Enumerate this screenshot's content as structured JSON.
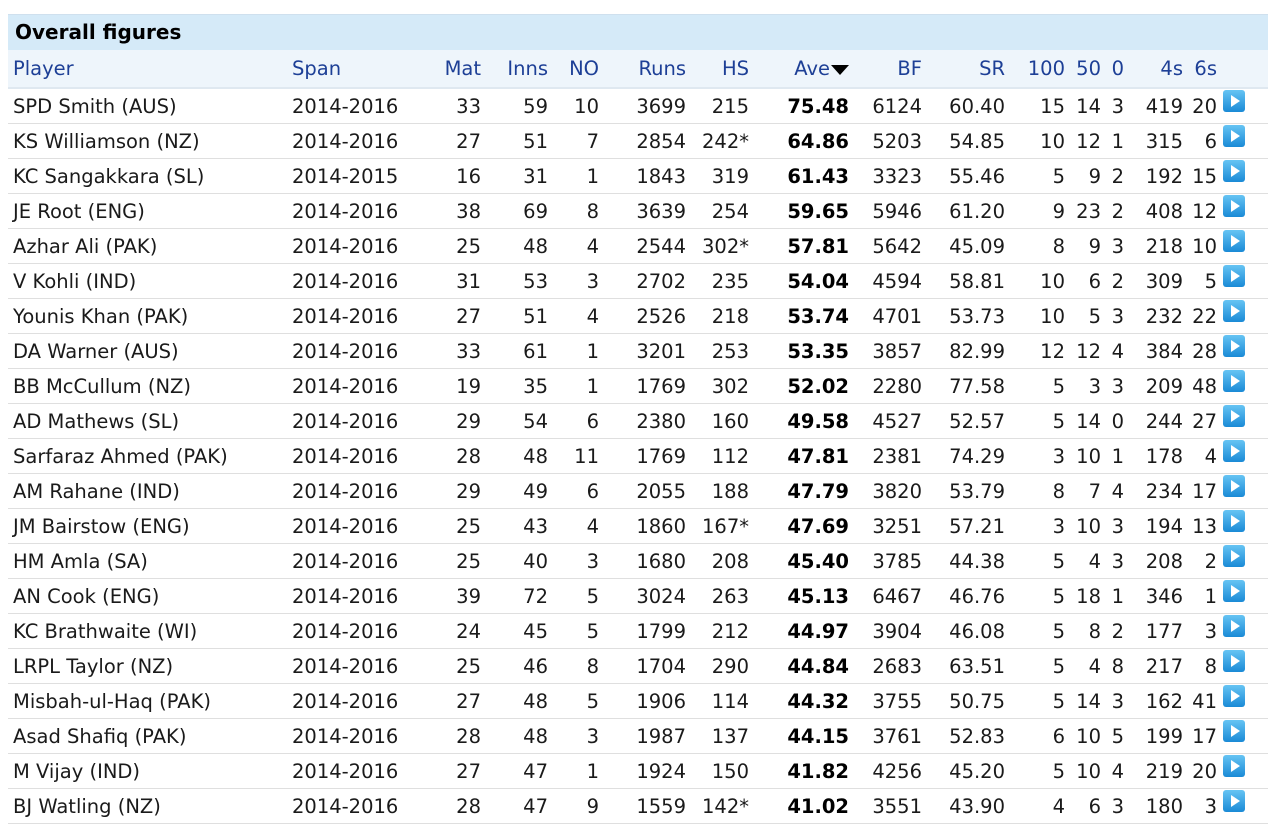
{
  "caption": "Overall figures",
  "columns": {
    "player": "Player",
    "span": "Span",
    "mat": "Mat",
    "inns": "Inns",
    "no": "NO",
    "runs": "Runs",
    "hs": "HS",
    "ave": "Ave",
    "bf": "BF",
    "sr": "SR",
    "hundreds": "100",
    "fifties": "50",
    "ducks": "0",
    "fours": "4s",
    "sixes": "6s"
  },
  "sorted_column": "Ave",
  "sort_icon": "sort-descending-icon",
  "row_icon": "play-arrow-icon",
  "colors": {
    "caption_bg": "#d5eaf8",
    "header_text": "#1d3f96",
    "icon": "#2a95dd"
  },
  "rows": [
    {
      "player": "SPD Smith (AUS)",
      "span": "2014-2016",
      "mat": "33",
      "inns": "59",
      "no": "10",
      "runs": "3699",
      "hs": "215",
      "ave": "75.48",
      "bf": "6124",
      "sr": "60.40",
      "hundreds": "15",
      "fifties": "14",
      "ducks": "3",
      "fours": "419",
      "sixes": "20"
    },
    {
      "player": "KS Williamson (NZ)",
      "span": "2014-2016",
      "mat": "27",
      "inns": "51",
      "no": "7",
      "runs": "2854",
      "hs": "242*",
      "ave": "64.86",
      "bf": "5203",
      "sr": "54.85",
      "hundreds": "10",
      "fifties": "12",
      "ducks": "1",
      "fours": "315",
      "sixes": "6"
    },
    {
      "player": "KC Sangakkara (SL)",
      "span": "2014-2015",
      "mat": "16",
      "inns": "31",
      "no": "1",
      "runs": "1843",
      "hs": "319",
      "ave": "61.43",
      "bf": "3323",
      "sr": "55.46",
      "hundreds": "5",
      "fifties": "9",
      "ducks": "2",
      "fours": "192",
      "sixes": "15"
    },
    {
      "player": "JE Root (ENG)",
      "span": "2014-2016",
      "mat": "38",
      "inns": "69",
      "no": "8",
      "runs": "3639",
      "hs": "254",
      "ave": "59.65",
      "bf": "5946",
      "sr": "61.20",
      "hundreds": "9",
      "fifties": "23",
      "ducks": "2",
      "fours": "408",
      "sixes": "12"
    },
    {
      "player": "Azhar Ali (PAK)",
      "span": "2014-2016",
      "mat": "25",
      "inns": "48",
      "no": "4",
      "runs": "2544",
      "hs": "302*",
      "ave": "57.81",
      "bf": "5642",
      "sr": "45.09",
      "hundreds": "8",
      "fifties": "9",
      "ducks": "3",
      "fours": "218",
      "sixes": "10"
    },
    {
      "player": "V Kohli (IND)",
      "span": "2014-2016",
      "mat": "31",
      "inns": "53",
      "no": "3",
      "runs": "2702",
      "hs": "235",
      "ave": "54.04",
      "bf": "4594",
      "sr": "58.81",
      "hundreds": "10",
      "fifties": "6",
      "ducks": "2",
      "fours": "309",
      "sixes": "5"
    },
    {
      "player": "Younis Khan (PAK)",
      "span": "2014-2016",
      "mat": "27",
      "inns": "51",
      "no": "4",
      "runs": "2526",
      "hs": "218",
      "ave": "53.74",
      "bf": "4701",
      "sr": "53.73",
      "hundreds": "10",
      "fifties": "5",
      "ducks": "3",
      "fours": "232",
      "sixes": "22"
    },
    {
      "player": "DA Warner (AUS)",
      "span": "2014-2016",
      "mat": "33",
      "inns": "61",
      "no": "1",
      "runs": "3201",
      "hs": "253",
      "ave": "53.35",
      "bf": "3857",
      "sr": "82.99",
      "hundreds": "12",
      "fifties": "12",
      "ducks": "4",
      "fours": "384",
      "sixes": "28"
    },
    {
      "player": "BB McCullum (NZ)",
      "span": "2014-2016",
      "mat": "19",
      "inns": "35",
      "no": "1",
      "runs": "1769",
      "hs": "302",
      "ave": "52.02",
      "bf": "2280",
      "sr": "77.58",
      "hundreds": "5",
      "fifties": "3",
      "ducks": "3",
      "fours": "209",
      "sixes": "48"
    },
    {
      "player": "AD Mathews (SL)",
      "span": "2014-2016",
      "mat": "29",
      "inns": "54",
      "no": "6",
      "runs": "2380",
      "hs": "160",
      "ave": "49.58",
      "bf": "4527",
      "sr": "52.57",
      "hundreds": "5",
      "fifties": "14",
      "ducks": "0",
      "fours": "244",
      "sixes": "27"
    },
    {
      "player": "Sarfaraz Ahmed (PAK)",
      "span": "2014-2016",
      "mat": "28",
      "inns": "48",
      "no": "11",
      "runs": "1769",
      "hs": "112",
      "ave": "47.81",
      "bf": "2381",
      "sr": "74.29",
      "hundreds": "3",
      "fifties": "10",
      "ducks": "1",
      "fours": "178",
      "sixes": "4"
    },
    {
      "player": "AM Rahane (IND)",
      "span": "2014-2016",
      "mat": "29",
      "inns": "49",
      "no": "6",
      "runs": "2055",
      "hs": "188",
      "ave": "47.79",
      "bf": "3820",
      "sr": "53.79",
      "hundreds": "8",
      "fifties": "7",
      "ducks": "4",
      "fours": "234",
      "sixes": "17"
    },
    {
      "player": "JM Bairstow (ENG)",
      "span": "2014-2016",
      "mat": "25",
      "inns": "43",
      "no": "4",
      "runs": "1860",
      "hs": "167*",
      "ave": "47.69",
      "bf": "3251",
      "sr": "57.21",
      "hundreds": "3",
      "fifties": "10",
      "ducks": "3",
      "fours": "194",
      "sixes": "13"
    },
    {
      "player": "HM Amla (SA)",
      "span": "2014-2016",
      "mat": "25",
      "inns": "40",
      "no": "3",
      "runs": "1680",
      "hs": "208",
      "ave": "45.40",
      "bf": "3785",
      "sr": "44.38",
      "hundreds": "5",
      "fifties": "4",
      "ducks": "3",
      "fours": "208",
      "sixes": "2"
    },
    {
      "player": "AN Cook (ENG)",
      "span": "2014-2016",
      "mat": "39",
      "inns": "72",
      "no": "5",
      "runs": "3024",
      "hs": "263",
      "ave": "45.13",
      "bf": "6467",
      "sr": "46.76",
      "hundreds": "5",
      "fifties": "18",
      "ducks": "1",
      "fours": "346",
      "sixes": "1"
    },
    {
      "player": "KC Brathwaite (WI)",
      "span": "2014-2016",
      "mat": "24",
      "inns": "45",
      "no": "5",
      "runs": "1799",
      "hs": "212",
      "ave": "44.97",
      "bf": "3904",
      "sr": "46.08",
      "hundreds": "5",
      "fifties": "8",
      "ducks": "2",
      "fours": "177",
      "sixes": "3"
    },
    {
      "player": "LRPL Taylor (NZ)",
      "span": "2014-2016",
      "mat": "25",
      "inns": "46",
      "no": "8",
      "runs": "1704",
      "hs": "290",
      "ave": "44.84",
      "bf": "2683",
      "sr": "63.51",
      "hundreds": "5",
      "fifties": "4",
      "ducks": "8",
      "fours": "217",
      "sixes": "8"
    },
    {
      "player": "Misbah-ul-Haq (PAK)",
      "span": "2014-2016",
      "mat": "27",
      "inns": "48",
      "no": "5",
      "runs": "1906",
      "hs": "114",
      "ave": "44.32",
      "bf": "3755",
      "sr": "50.75",
      "hundreds": "5",
      "fifties": "14",
      "ducks": "3",
      "fours": "162",
      "sixes": "41"
    },
    {
      "player": "Asad Shafiq (PAK)",
      "span": "2014-2016",
      "mat": "28",
      "inns": "48",
      "no": "3",
      "runs": "1987",
      "hs": "137",
      "ave": "44.15",
      "bf": "3761",
      "sr": "52.83",
      "hundreds": "6",
      "fifties": "10",
      "ducks": "5",
      "fours": "199",
      "sixes": "17"
    },
    {
      "player": "M Vijay (IND)",
      "span": "2014-2016",
      "mat": "27",
      "inns": "47",
      "no": "1",
      "runs": "1924",
      "hs": "150",
      "ave": "41.82",
      "bf": "4256",
      "sr": "45.20",
      "hundreds": "5",
      "fifties": "10",
      "ducks": "4",
      "fours": "219",
      "sixes": "20"
    },
    {
      "player": "BJ Watling (NZ)",
      "span": "2014-2016",
      "mat": "28",
      "inns": "47",
      "no": "9",
      "runs": "1559",
      "hs": "142*",
      "ave": "41.02",
      "bf": "3551",
      "sr": "43.90",
      "hundreds": "4",
      "fifties": "6",
      "ducks": "3",
      "fours": "180",
      "sixes": "3"
    }
  ]
}
